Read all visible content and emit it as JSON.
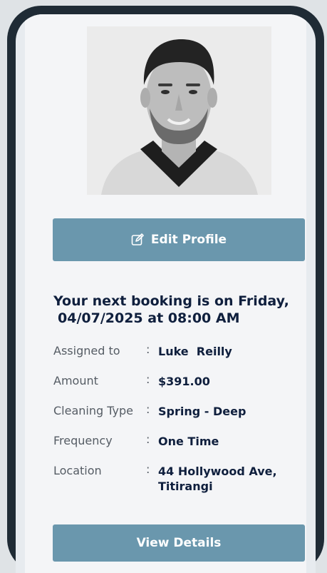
{
  "profile": {
    "edit_button_label": "Edit Profile",
    "edit_icon": "edit-icon"
  },
  "booking": {
    "headline_line1": "Your next booking is on Friday,",
    "headline_line2": "04/07/2025 at 08:00 AM",
    "details": [
      {
        "label": "Assigned to",
        "value": "Luke  Reilly"
      },
      {
        "label": "Amount",
        "value": "$391.00"
      },
      {
        "label": "Cleaning Type",
        "value": "Spring - Deep"
      },
      {
        "label": "Frequency",
        "value": "One Time"
      },
      {
        "label": "Location",
        "value": "44 Hollywood Ave, Titirangi"
      }
    ],
    "separator": ":",
    "view_details_label": "View Details"
  },
  "colors": {
    "button": "#6a97ad",
    "heading": "#0f1f3d",
    "frame": "#1f2b35"
  }
}
